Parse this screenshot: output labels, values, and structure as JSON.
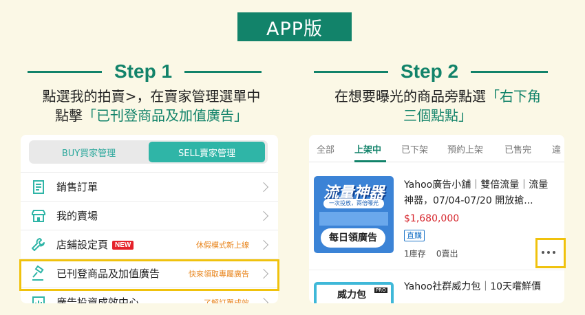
{
  "header": {
    "badge": "APP版"
  },
  "step1": {
    "title": "Step 1",
    "desc_line1": "點選我的拍賣>，在賣家管理選單中",
    "desc_line2_prefix": "點擊",
    "desc_line2_highlight": "「已刊登商品及加值廣告」",
    "toggle": {
      "buy": "BUY買家管理",
      "sell": "SELL賣家管理"
    },
    "menu": [
      {
        "label": "銷售訂單",
        "icon": "receipt-icon",
        "note": "",
        "badge": ""
      },
      {
        "label": "我的賣場",
        "icon": "store-icon",
        "note": "",
        "badge": ""
      },
      {
        "label": "店鋪設定頁",
        "icon": "wrench-icon",
        "note": "休假模式新上線",
        "badge": "NEW"
      },
      {
        "label": "已刊登商品及加值廣告",
        "icon": "gavel-icon",
        "note": "快來領取專屬廣告",
        "badge": ""
      },
      {
        "label": "廣告投資成效中心",
        "icon": "chart-icon",
        "note": "了解訂單成效",
        "badge": ""
      }
    ]
  },
  "step2": {
    "title": "Step 2",
    "desc_line1_prefix": "在想要曝光的商品旁點選",
    "desc_line1_highlight": "「右下角",
    "desc_line2_highlight": "三個點點」",
    "tabs": [
      "全部",
      "上架中",
      "已下架",
      "預約上架",
      "已售完",
      "違"
    ],
    "products": [
      {
        "title": "Yahoo廣告小舖｜雙倍流量｜流量神器，07/04-07/20 開放搶...",
        "price": "$1,680,000",
        "tag": "直購",
        "stock": "1庫存",
        "sold": "0賣出",
        "img_title": "流量神器",
        "img_sub": "一次投放，兩倍曝光",
        "img_cta": "每日領廣告"
      },
      {
        "title": "Yahoo社群威力包｜10天嚐鮮價",
        "img_title": "威力包",
        "img_tag": "PRO"
      }
    ]
  },
  "colors": {
    "brand_green": "#12836a",
    "teal": "#2fb5a7",
    "highlight_yellow": "#f0c20d",
    "price_red": "#d6262d"
  }
}
